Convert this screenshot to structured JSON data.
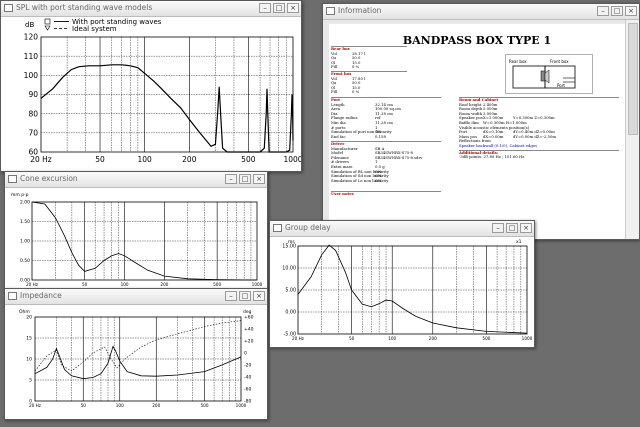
{
  "windows": {
    "spl": {
      "title": "SPL with port standing wave models",
      "ylabel": "dB",
      "legend": [
        "With port standing waves",
        "Ideal system"
      ],
      "yticks": [
        "120",
        "110",
        "100",
        "90",
        "80",
        "70",
        "60"
      ],
      "xticks": [
        "20 Hz",
        "50",
        "100",
        "200",
        "500",
        "1000"
      ]
    },
    "cone": {
      "title": "Cone excursion",
      "ylabel": "mm p-p",
      "yticks": [
        "2.00",
        "1.50",
        "1.00",
        "0.50",
        "0.00"
      ],
      "xticks": [
        "20 Hz",
        "50",
        "100",
        "200",
        "500",
        "1000"
      ]
    },
    "impedance": {
      "title": "Impedance",
      "ylabel_left": "Ohm",
      "ylabel_right": "deg",
      "yticks_left": [
        "20",
        "15",
        "10",
        "5",
        "0"
      ],
      "yticks_right": [
        "+60",
        "+40",
        "+20",
        "0",
        "-20",
        "-40",
        "-60",
        "-80"
      ],
      "xticks": [
        "20 Hz",
        "50",
        "100",
        "200",
        "500",
        "1000"
      ]
    },
    "group_delay": {
      "title": "Group delay",
      "ylabel": "ms",
      "yticks": [
        "15.00",
        "10.00",
        "5.00",
        "0.00",
        "-5.00"
      ],
      "xticks": [
        "20 Hz",
        "50",
        "100",
        "200",
        "500",
        "1000"
      ],
      "corner": "x1"
    },
    "info": {
      "title": "Information",
      "heading": "BANDPASS BOX TYPE 1",
      "rear_box": {
        "label": "Rear box",
        "rows": [
          [
            "Vol",
            "28.17 l"
          ],
          [
            "Qa",
            "50.0"
          ],
          [
            "Ql",
            "15.0"
          ],
          [
            "Fill",
            "0 %"
          ]
        ]
      },
      "front_box": {
        "label": "Front box",
        "rows": [
          [
            "Vol",
            "17.80 l"
          ],
          [
            "Qa",
            "50.0"
          ],
          [
            "Ql",
            "15.0"
          ],
          [
            "Fill",
            "0 %"
          ]
        ]
      },
      "port": {
        "label": "Port",
        "rows": [
          [
            "Length",
            "32.14 cm"
          ],
          [
            "Area",
            "100.00 sq.cm"
          ],
          [
            "Dia",
            "11.28 cm"
          ],
          [
            "Flange radius",
            "ref"
          ],
          [
            "Min dia",
            "11.28 cm"
          ],
          [
            "# ports",
            "1"
          ],
          [
            "Simulation of port non linearity",
            "ON"
          ],
          [
            "End fac",
            "0.158"
          ]
        ]
      },
      "driver": {
        "label": "Driver",
        "rows": [
          [
            "Manufacturer",
            "SB A"
          ],
          [
            "Model",
            "SB34SWNRX-S75-8"
          ],
          [
            "Filename",
            "SB34SWNRX-S75-8.sdrv"
          ],
          [
            "# drivers",
            "1"
          ],
          [
            "Extra mass",
            "0.0 g"
          ],
          [
            "Simulation of BL non linearity",
            "ON"
          ],
          [
            "Simulation of Sd non linearity",
            "ON"
          ],
          [
            "Simulation of Le non linearity",
            "ON"
          ]
        ]
      },
      "room": {
        "label": "Room and Cabinet",
        "rows": [
          [
            "Roof height",
            "2.400m",
            ""
          ],
          [
            "Room depth",
            "5.000m",
            ""
          ],
          [
            "Room width",
            "3.000m",
            ""
          ],
          [
            "Speaker pos",
            "X=1.000m",
            "Y=0.300m  Z=0.300m"
          ],
          [
            "Baffle dim",
            "W=0.300m  H=1.000m",
            ""
          ],
          [
            "Visible acoustic elements position(s)",
            "",
            ""
          ],
          [
            "Port",
            "dX=0.10m",
            "dY=0.40m  dZ=0.00m"
          ],
          [
            "Mass pos",
            "dX=0.00m",
            "dY=0.00m  dZ=-2.50m"
          ],
          [
            "Reflections from",
            "",
            ""
          ]
        ]
      },
      "speaker_note": "Speaker backwall (0.1/0), Cabinet edges",
      "additional": {
        "label": "Additional details:",
        "text": "-3dB points:   27.80 Hz  ;  101.60 Hz"
      },
      "user_notes": "User notes",
      "diagram": {
        "rear": "Rear box",
        "front": "Front box",
        "port": "Port"
      }
    }
  }
}
